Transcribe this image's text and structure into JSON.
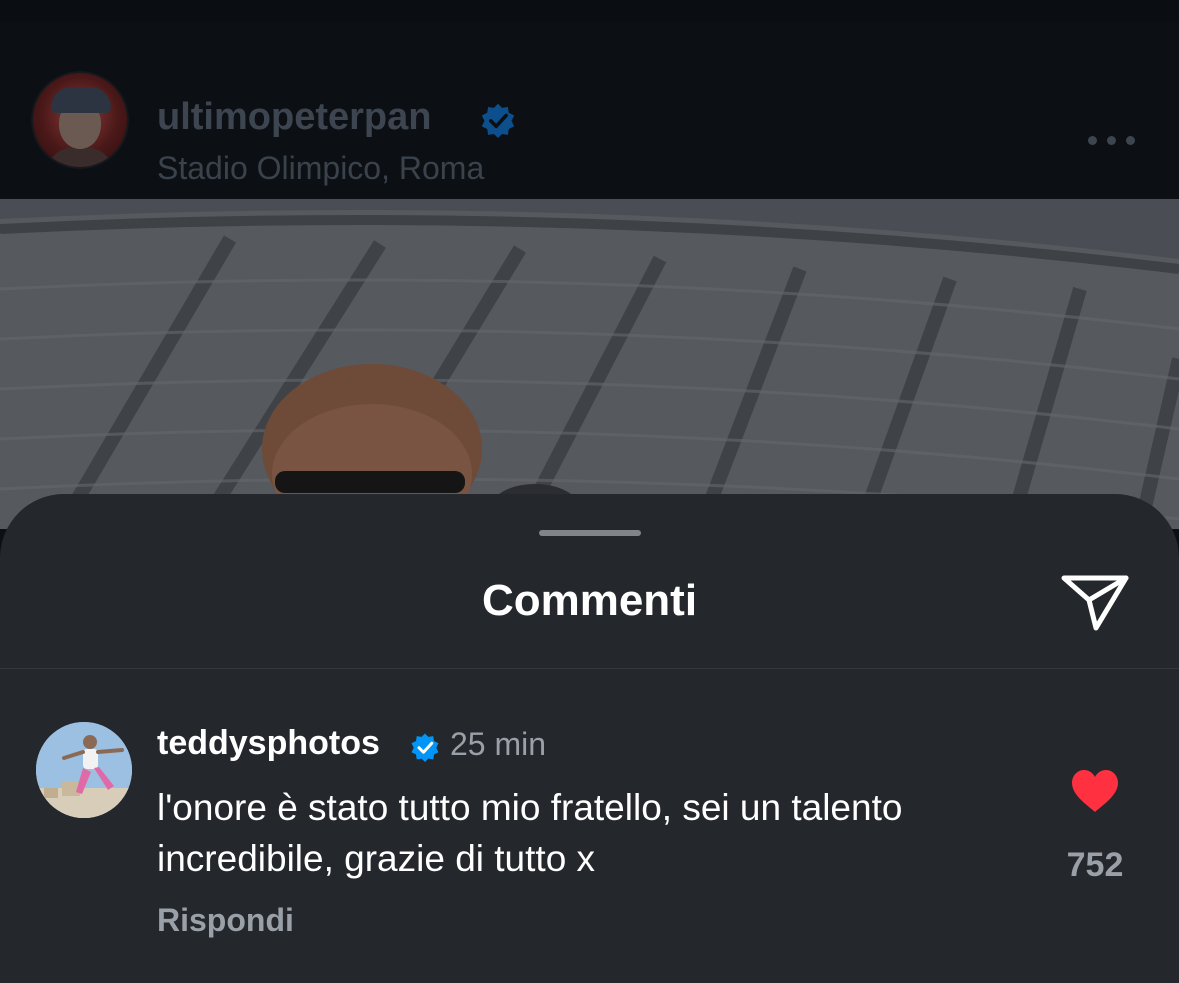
{
  "post": {
    "username": "ultimopeterpan",
    "location": "Stadio Olimpico, Roma",
    "verified_color": "#0d4f8c"
  },
  "comments_sheet": {
    "title": "Commenti",
    "comment": {
      "username": "teddysphotos",
      "time": "25 min",
      "text": "l'onore è stato tutto mio fratello, sei un talento incredibile, grazie di tutto x",
      "reply_label": "Rispondi",
      "like_count": "752",
      "liked": true,
      "heart_color": "#ff3040",
      "verified_color": "#0095f6"
    }
  },
  "icons": {
    "more": "more-horizontal-icon",
    "share": "paper-plane-icon",
    "like": "heart-icon",
    "verified": "verified-badge-icon"
  }
}
